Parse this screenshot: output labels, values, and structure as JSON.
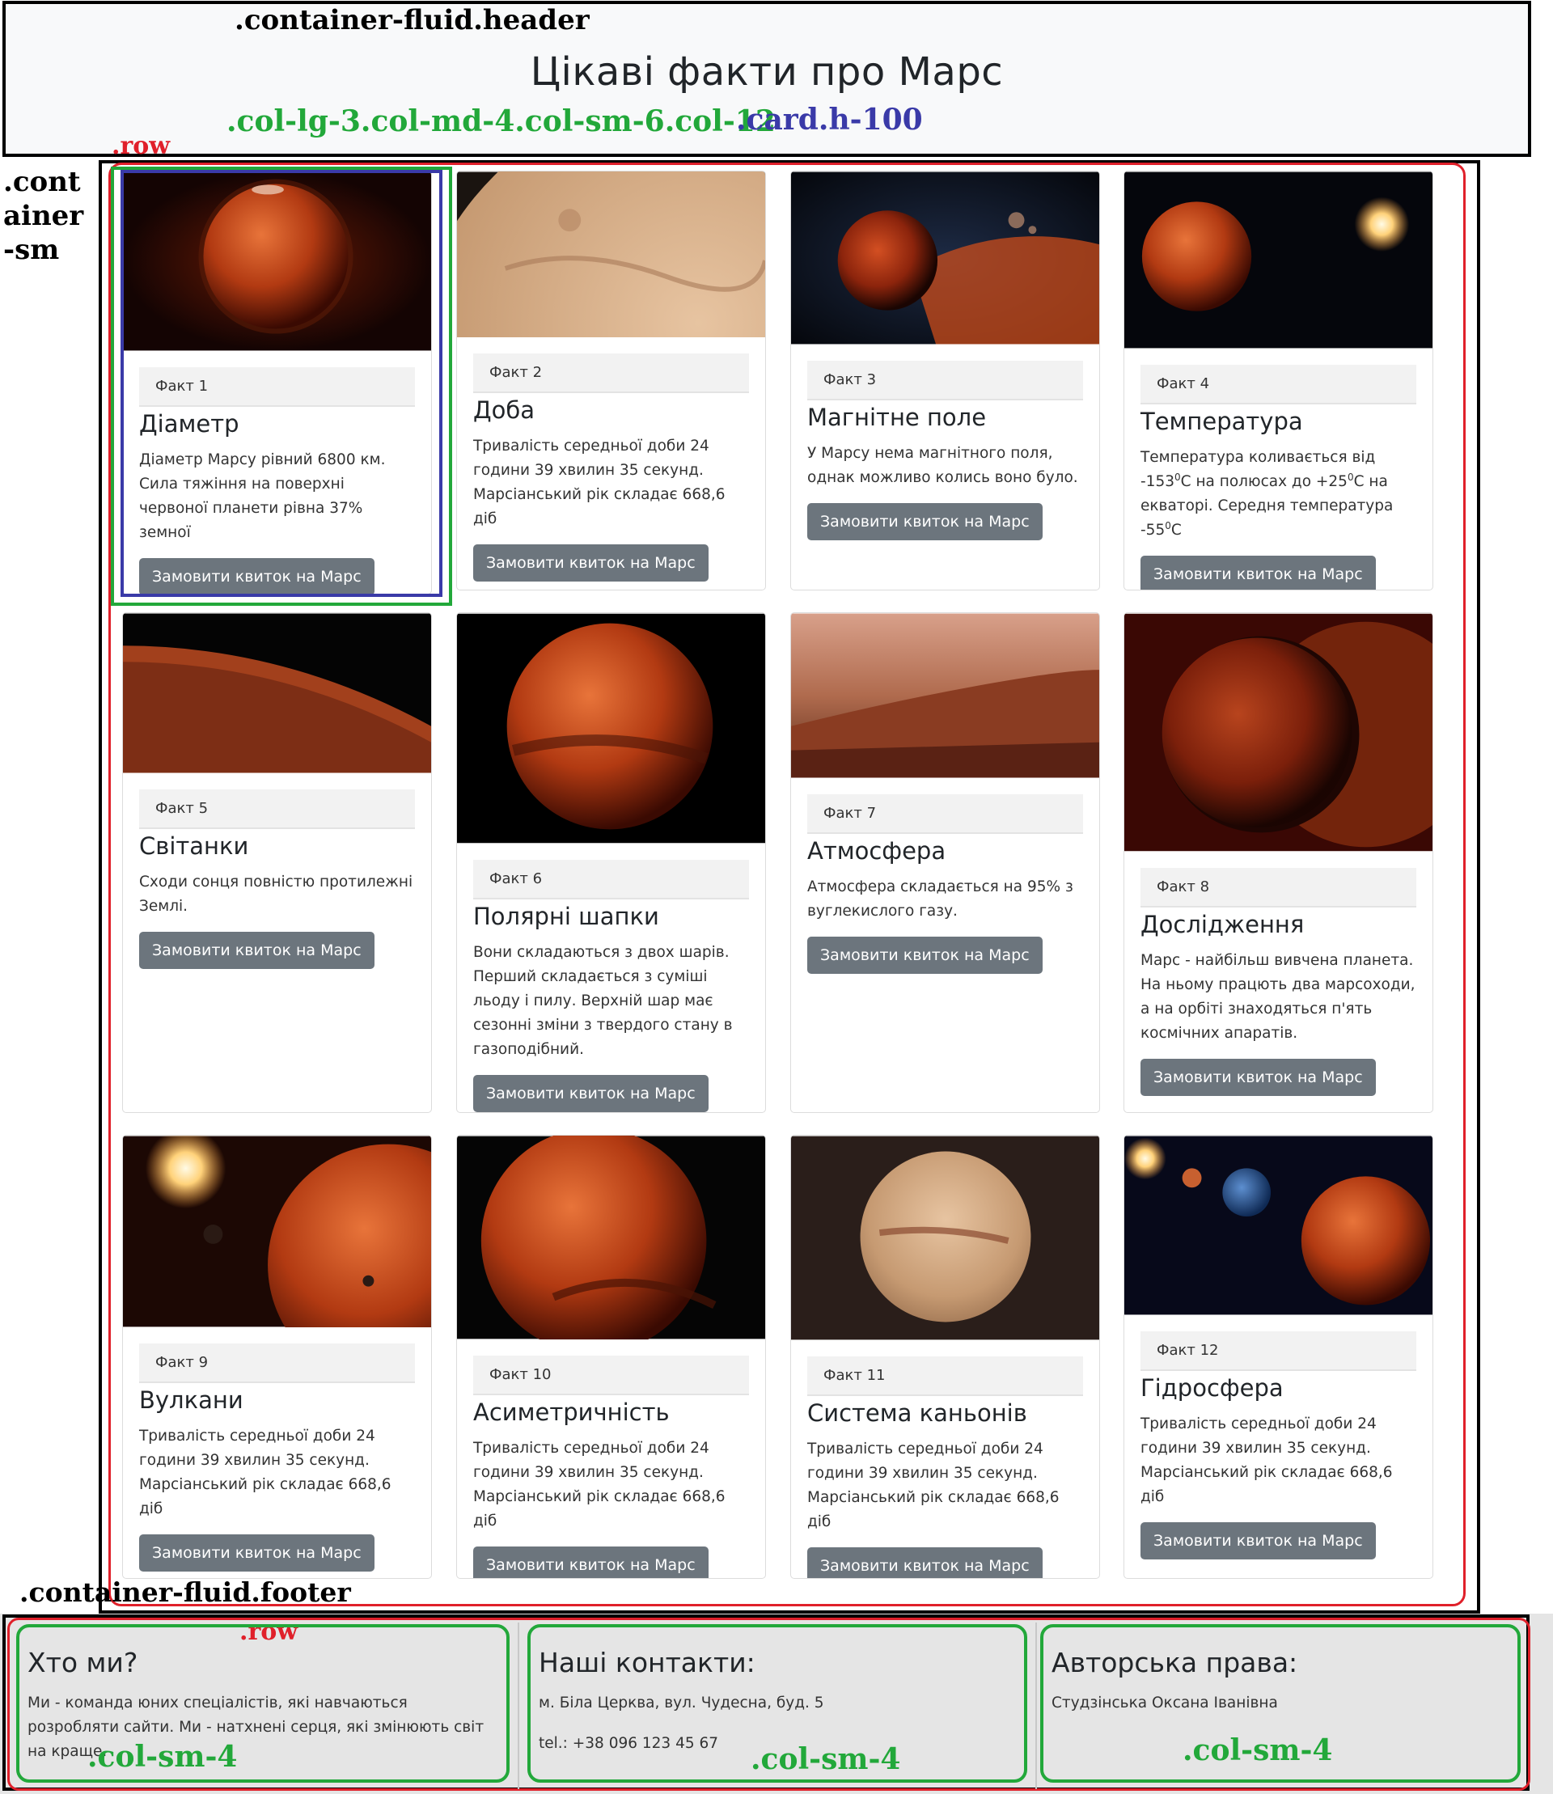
{
  "annotations": {
    "header_class": ".container-fluid.header",
    "col_class": ".col-lg-3.col-md-4.col-sm-6.col-12",
    "card_class": ".card.h-100",
    "row_class": ".row",
    "container_class": ".cont\nainer\n-sm",
    "footer_class": ".container-fluid.footer",
    "footer_row_class": ".row",
    "footer_col_class": ".col-sm-4"
  },
  "header": {
    "title": "Цікаві факти про Марс"
  },
  "cards": [
    {
      "label": "Факт 1",
      "title": "Діаметр",
      "text": "Діаметр Марсу рівний 6800 км. Сила тяжіння на поверхні червоної планети рівна 37% земної",
      "button": "Замовити квиток на Марс"
    },
    {
      "label": "Факт 2",
      "title": "Доба",
      "text": "Тривалість середньої доби 24 години 39 хвилин 35 секунд. Марсіанський рік складає 668,6 діб",
      "button": "Замовити квиток на Марс"
    },
    {
      "label": "Факт 3",
      "title": "Магнітне поле",
      "text": "У Марсу нема магнітного поля, однак можливо колись воно було.",
      "button": "Замовити квиток на Марс"
    },
    {
      "label": "Факт 4",
      "title": "Температура",
      "text_parts": [
        "Температура коливається від -153",
        "0",
        "C на полюсах до +25",
        "0",
        "C на екваторі. Середня температура -55",
        "0",
        "C"
      ],
      "button": "Замовити квиток на Марс"
    },
    {
      "label": "Факт 5",
      "title": "Світанки",
      "text": "Сходи сонця повністю протилежні Землі.",
      "button": "Замовити квиток на Марс"
    },
    {
      "label": "Факт 6",
      "title": "Полярні шапки",
      "text": "Вони складаються з двох шарів. Перший складається з суміші льоду і пилу. Верхній шар має сезонні зміни з твердого стану в газоподібний.",
      "button": "Замовити квиток на Марс"
    },
    {
      "label": "Факт 7",
      "title": "Атмосфера",
      "text": "Атмосфера складається на 95% з вуглекислого газу.",
      "button": "Замовити квиток на Марс"
    },
    {
      "label": "Факт 8",
      "title": "Дослідження",
      "text": "Марс - найбільш вивчена планета. На ньому працють два марсоходи, а на орбіті знаходяться п'ять космічних апаратів.",
      "button": "Замовити квиток на Марс"
    },
    {
      "label": "Факт 9",
      "title": "Вулкани",
      "text": "Тривалість середньої доби 24 години 39 хвилин 35 секунд. Марсіанський рік складає 668,6 діб",
      "button": "Замовити квиток на Марс"
    },
    {
      "label": "Факт 10",
      "title": "Асиметричність",
      "text": "Тривалість середньої доби 24 години 39 хвилин 35 секунд. Марсіанський рік складає 668,6 діб",
      "button": "Замовити квиток на Марс"
    },
    {
      "label": "Факт 11",
      "title": "Система каньонів",
      "text": "Тривалість середньої доби 24 години 39 хвилин 35 секунд. Марсіанський рік складає 668,6 діб",
      "button": "Замовити квиток на Марс"
    },
    {
      "label": "Факт 12",
      "title": "Гідросфера",
      "text": "Тривалість середньої доби 24 години 39 хвилин 35 секунд. Марсіанський рік складає 668,6 діб",
      "button": "Замовити квиток на Марс"
    }
  ],
  "footer": {
    "about": {
      "heading": "Хто ми?",
      "text": "Ми - команда юних спеціалістів, які навчаються розробляти сайти. Ми - натхнені серця, які змінюють світ на краще."
    },
    "contacts": {
      "heading": "Наші контакти:",
      "address": "м. Біла Церква, вул. Чудесна, буд. 5",
      "phone": "tel.: +38 096 123 45 67"
    },
    "copyright": {
      "heading": "Авторська права:",
      "author": "Студзінська Оксана Іванівна"
    }
  },
  "colors": {
    "button_bg": "#6c757d",
    "annotation_red": "#e0202a",
    "annotation_green": "#22a83a",
    "annotation_blue": "#3a3aa8"
  }
}
